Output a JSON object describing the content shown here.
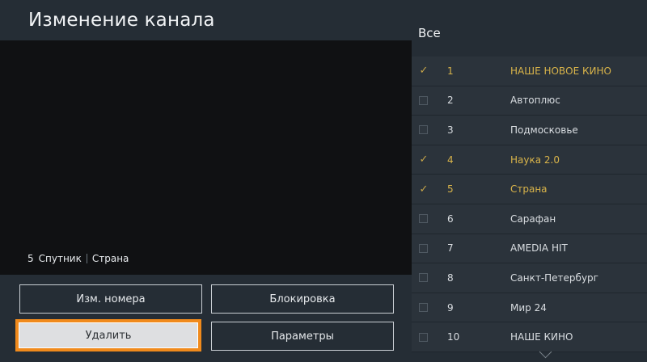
{
  "screen": {
    "title": "Изменение канала"
  },
  "preview": {
    "number": "5",
    "source": "Спутник",
    "channel": "Страна"
  },
  "buttons": {
    "edit_number": "Изм. номера",
    "lock": "Блокировка",
    "delete": "Удалить",
    "options": "Параметры"
  },
  "list": {
    "header": "Все",
    "items": [
      {
        "number": "1",
        "name": "НАШЕ НОВОЕ КИНО",
        "checked": true
      },
      {
        "number": "2",
        "name": "Автоплюс",
        "checked": false
      },
      {
        "number": "3",
        "name": "Подмосковье",
        "checked": false
      },
      {
        "number": "4",
        "name": "Наука 2.0",
        "checked": true
      },
      {
        "number": "5",
        "name": "Страна",
        "checked": true
      },
      {
        "number": "6",
        "name": "Сарафан",
        "checked": false
      },
      {
        "number": "7",
        "name": "AMEDIA HIT",
        "checked": false
      },
      {
        "number": "8",
        "name": "Санкт-Петербург",
        "checked": false
      },
      {
        "number": "9",
        "name": "Мир 24",
        "checked": false
      },
      {
        "number": "10",
        "name": "НАШЕ КИНО",
        "checked": false
      }
    ]
  },
  "colors": {
    "accent_focus": "#f08a1c",
    "selected_text": "#d9b44a",
    "background": "#252d35"
  }
}
